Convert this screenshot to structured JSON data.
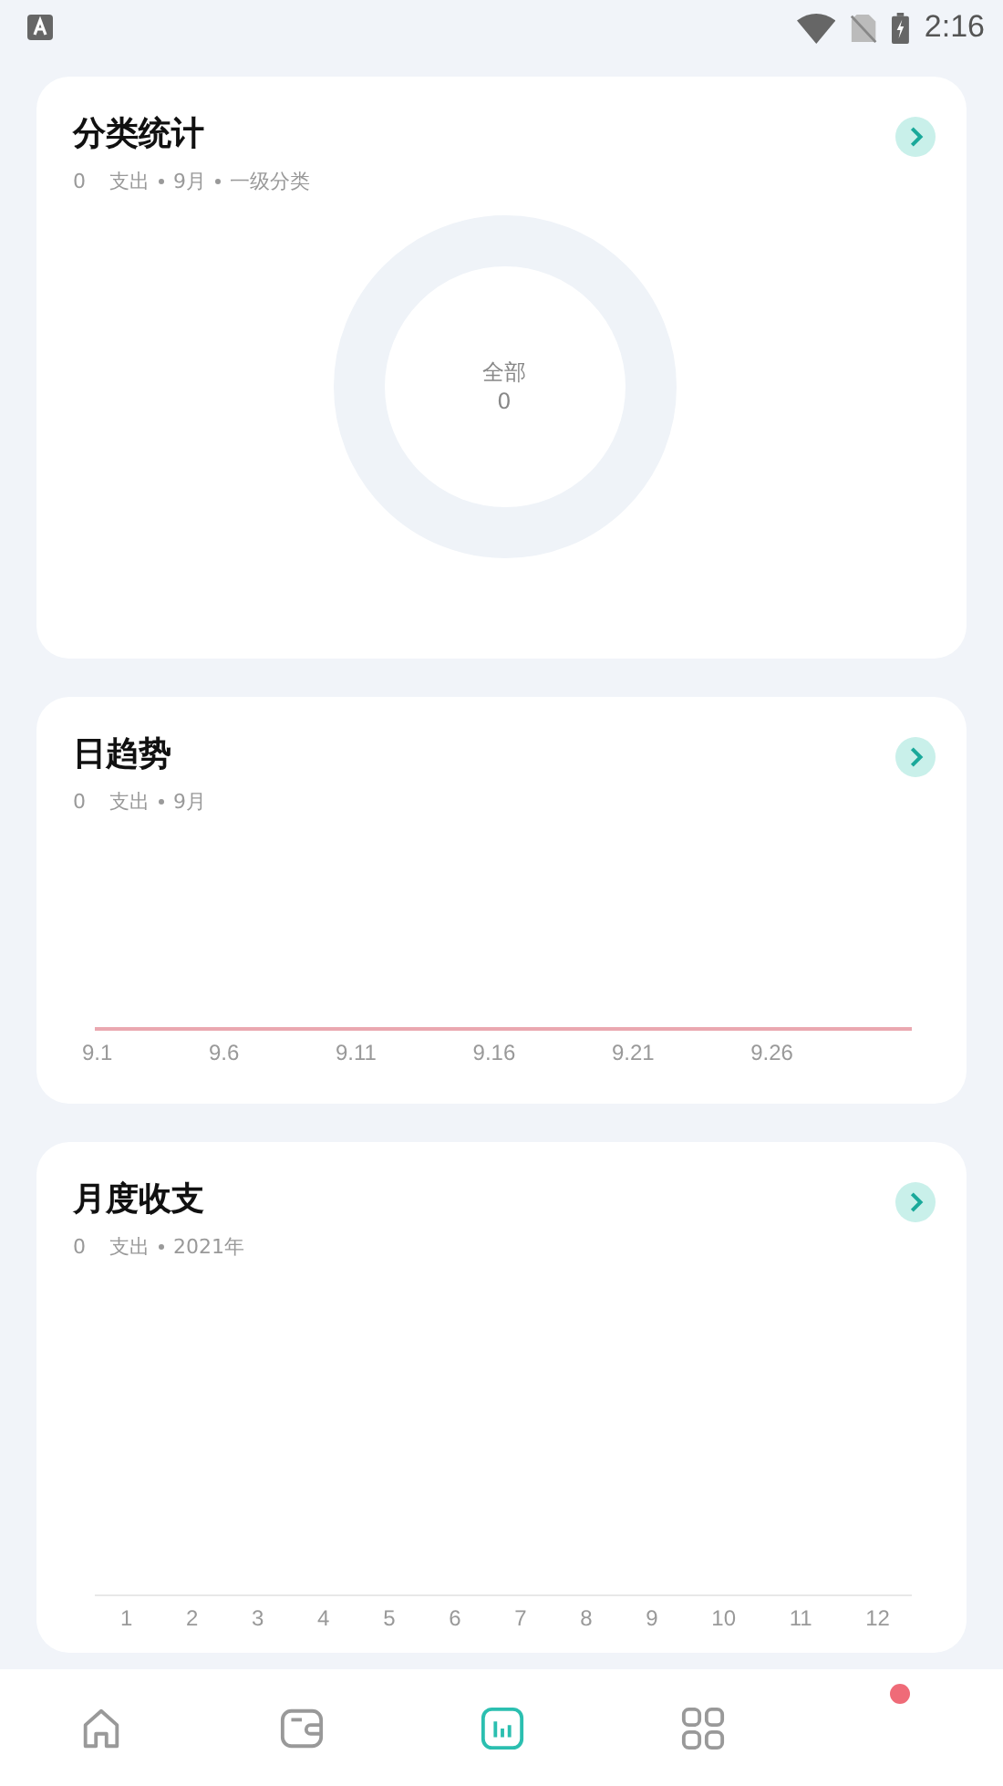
{
  "status_bar": {
    "time": "2:16"
  },
  "category_card": {
    "title": "分类统计",
    "subtitle": [
      "0",
      "支出",
      "9月",
      "一级分类"
    ],
    "donut_label": "全部",
    "donut_value": "0"
  },
  "daily_card": {
    "title": "日趋势",
    "subtitle": [
      "0",
      "支出",
      "9月"
    ],
    "x_labels": [
      "9.1",
      "9.6",
      "9.11",
      "9.16",
      "9.21",
      "9.26"
    ]
  },
  "monthly_card": {
    "title": "月度收支",
    "subtitle": [
      "0",
      "支出",
      "2021年"
    ],
    "x_labels": [
      "1",
      "2",
      "3",
      "4",
      "5",
      "6",
      "7",
      "8",
      "9",
      "10",
      "11",
      "12"
    ]
  },
  "bottom_nav": [
    {
      "kind": "home",
      "selected": false,
      "badge": false
    },
    {
      "kind": "wallet",
      "selected": false,
      "badge": false
    },
    {
      "kind": "chart",
      "selected": true,
      "badge": false
    },
    {
      "kind": "grid",
      "selected": false,
      "badge": false
    },
    {
      "kind": "other",
      "badge": true
    }
  ]
}
